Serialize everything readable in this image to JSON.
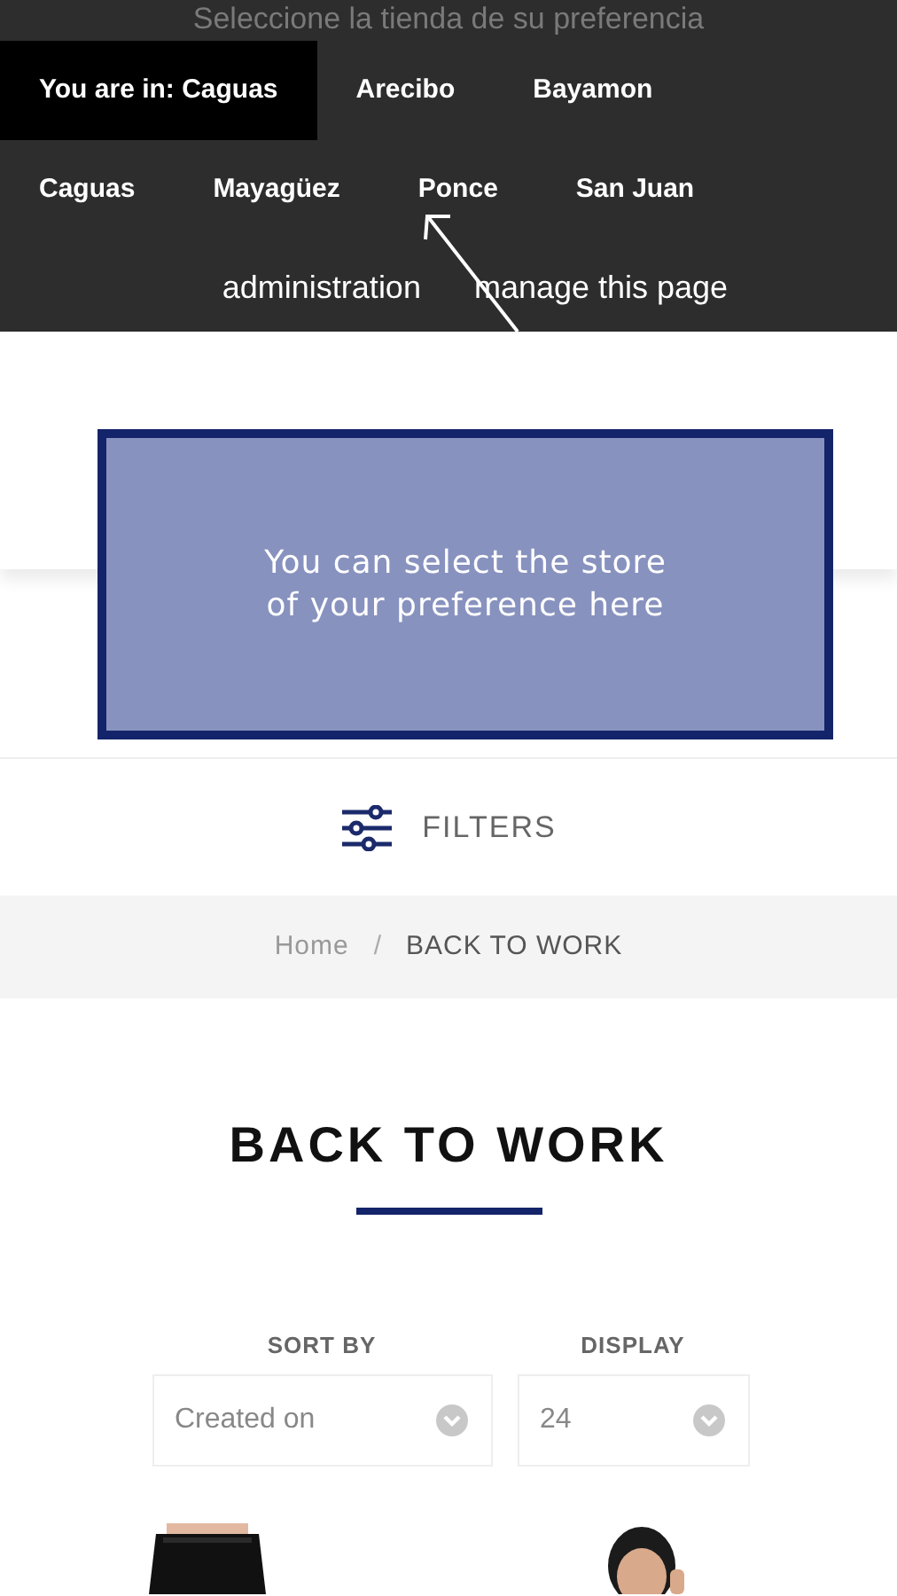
{
  "store_bar": {
    "heading": "Seleccione la tienda de su preferencia",
    "stores": [
      {
        "label": "You are in: Caguas",
        "selected": true
      },
      {
        "label": "Arecibo",
        "selected": false
      },
      {
        "label": "Bayamon",
        "selected": false
      },
      {
        "label": "Caguas",
        "selected": false
      },
      {
        "label": "Mayagüez",
        "selected": false
      },
      {
        "label": "Ponce",
        "selected": false
      },
      {
        "label": "San Juan",
        "selected": false
      }
    ],
    "links": [
      "administration",
      "manage this page"
    ]
  },
  "callout": {
    "text": "You can select the store of your preference here"
  },
  "filters": {
    "label": "FILTERS"
  },
  "breadcrumb": {
    "items": [
      "Home",
      "BACK TO WORK"
    ],
    "separator": "/"
  },
  "title": "BACK TO WORK",
  "controls": [
    {
      "label": "SORT BY",
      "value": "Created on"
    },
    {
      "label": "DISPLAY",
      "value": "24"
    }
  ]
}
